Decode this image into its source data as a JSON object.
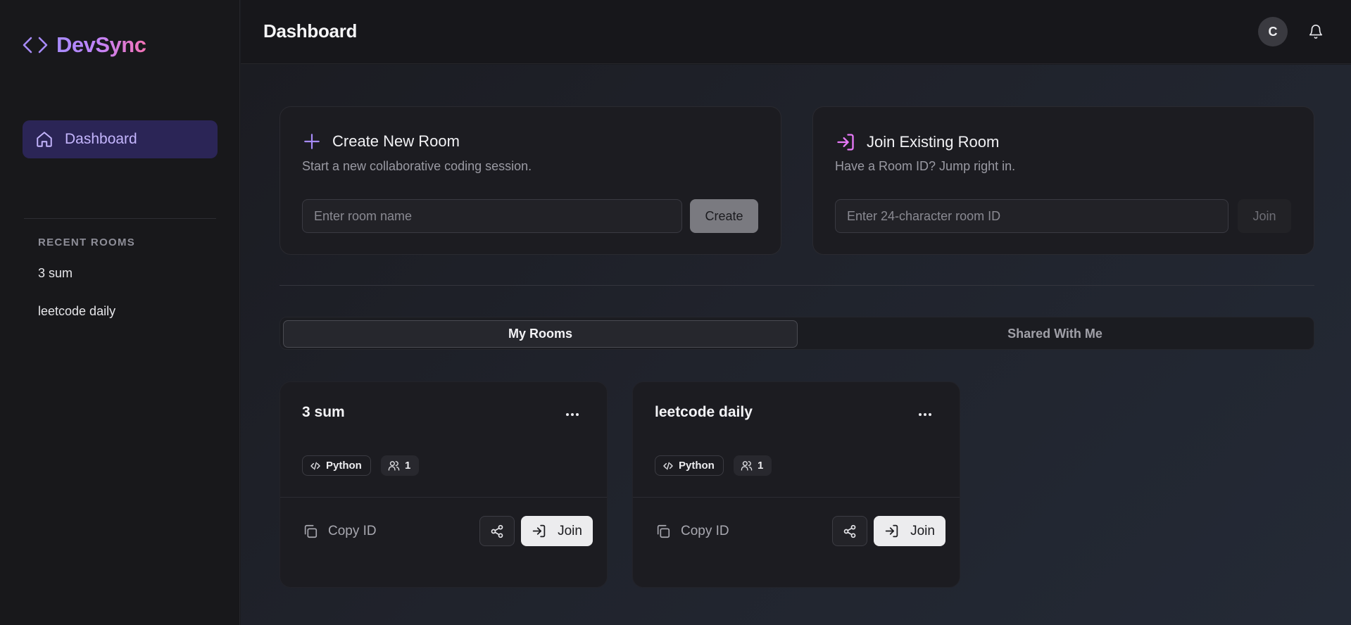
{
  "app": {
    "name": "DevSync",
    "brand_gradient": [
      "#a78bfa",
      "#c084fc",
      "#f472b6"
    ],
    "logo_icon": "code-brackets-icon"
  },
  "sidebar": {
    "nav": [
      {
        "label": "Dashboard",
        "icon": "home-icon",
        "active": true
      }
    ],
    "recent_rooms_title": "RECENT ROOMS",
    "recent_rooms": [
      "3 sum",
      "leetcode daily"
    ]
  },
  "header": {
    "title": "Dashboard",
    "avatar_initial": "C",
    "notification_icon": "bell-icon"
  },
  "create_room": {
    "icon": "plus-icon",
    "title": "Create New Room",
    "description": "Start a new collaborative coding session.",
    "placeholder": "Enter room name",
    "value": "",
    "button_label": "Create"
  },
  "join_room": {
    "icon": "sign-in-icon",
    "title": "Join Existing Room",
    "description": "Have a Room ID? Jump right in.",
    "placeholder": "Enter 24-character room ID",
    "value": "",
    "button_label": "Join"
  },
  "tabs": [
    {
      "label": "My Rooms",
      "active": true
    },
    {
      "label": "Shared With Me",
      "active": false
    }
  ],
  "rooms": [
    {
      "name": "3 sum",
      "language": "Python",
      "members": "1",
      "copy_label": "Copy ID",
      "join_label": "Join"
    },
    {
      "name": "leetcode daily",
      "language": "Python",
      "members": "1",
      "copy_label": "Copy ID",
      "join_label": "Join"
    }
  ],
  "colors": {
    "accent": "#a78bfa",
    "join_accent": "#e879f9",
    "nav_active_bg": "#2b2556"
  }
}
